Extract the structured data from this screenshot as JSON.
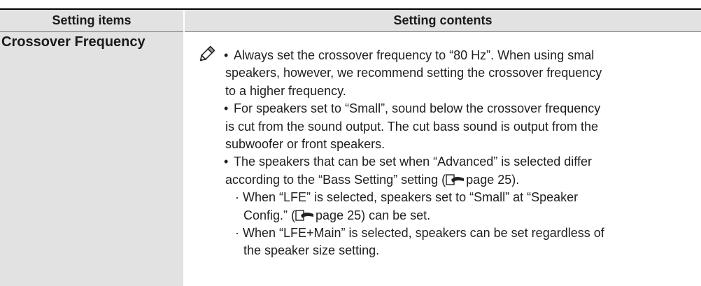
{
  "table": {
    "header": {
      "col1": "Setting items",
      "col2": "Setting contents"
    },
    "row": {
      "item": "Crossover Frequency",
      "note_icon": "pencil-icon",
      "bullet1": [
        "Always set the crossover frequency to “80 Hz”. When using smal",
        "speakers, however, we recommend setting the crossover frequency",
        "to a higher frequency."
      ],
      "bullet2": [
        "For speakers set to “Small”, sound below the crossover frequency",
        "is cut from the sound output. The cut bass sound is output from the",
        "subwoofer or front speakers."
      ],
      "bullet3": [
        "The speakers that can be set when “Advanced” is selected differ",
        "according to the “Bass Setting” setting ("
      ],
      "bullet3_ref": "page 25).",
      "sub1": [
        "· When “LFE” is selected, speakers set to “Small” at “Speaker",
        "Config.” ("
      ],
      "sub1_ref": "page 25) can be set.",
      "sub2": [
        "· When “LFE+Main” is selected, speakers can be set regardless of",
        "the speaker size setting."
      ],
      "ref_icon": "page-reference-icon"
    }
  }
}
